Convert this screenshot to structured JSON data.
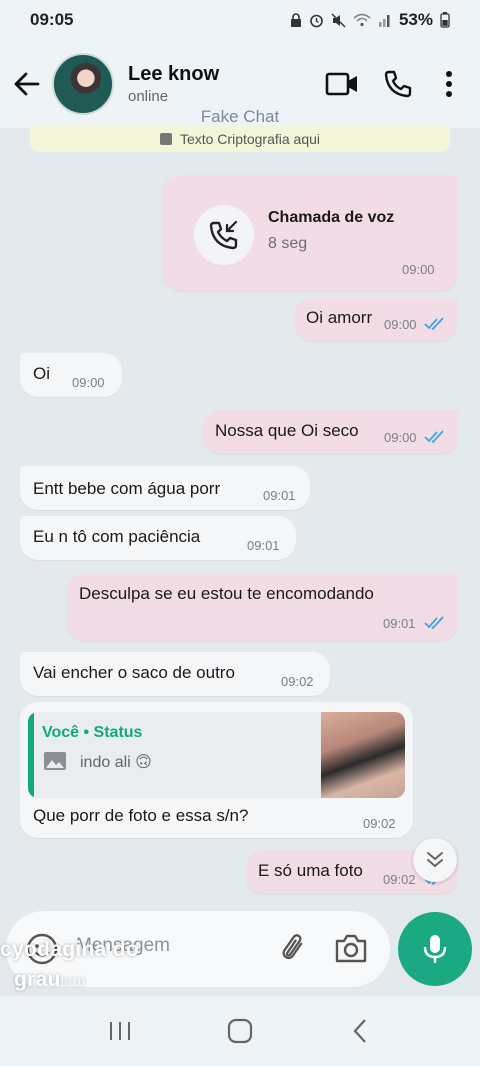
{
  "status_bar": {
    "time": "09:05",
    "battery": "53%",
    "icons": [
      "lock-icon",
      "alarm-icon",
      "mute-icon",
      "wifi-icon",
      "signal-icon",
      "battery-icon"
    ]
  },
  "header": {
    "contact_name": "Lee know",
    "contact_status": "online",
    "watermark": "Fake Chat"
  },
  "encryption_note": "Texto Criptografia aqui",
  "messages": {
    "call": {
      "title": "Chamada de voz",
      "duration": "8 seg",
      "time": "09:00"
    },
    "m1": {
      "text": "Oi amorr",
      "time": "09:00"
    },
    "m2": {
      "text": "Oi",
      "time": "09:00"
    },
    "m3": {
      "text": "Nossa que Oi seco",
      "time": "09:00"
    },
    "m4": {
      "text": "Entt bebe com água porr",
      "time": "09:01"
    },
    "m5": {
      "text": "Eu n tô com paciência",
      "time": "09:01"
    },
    "m6": {
      "text": "Desculpa se eu estou te encomodando",
      "time": "09:01"
    },
    "m7": {
      "text": "Vai encher o saco de outro",
      "time": "09:02"
    },
    "m8": {
      "reply_author": "Você • Status",
      "reply_text": "indo ali 🙃",
      "text": "Que porr de foto e essa s/n?",
      "time": "09:02"
    },
    "m9": {
      "text": "E só uma foto",
      "time": "09:02"
    }
  },
  "composer": {
    "placeholder": "Mensagem"
  },
  "overlay": {
    "line1": "cyodagina do",
    "line2": "grau",
    "line2_suffix": "8/10"
  },
  "colors": {
    "outgoing_bubble": "#f2dce6",
    "incoming_bubble": "#f4f6f8",
    "accent": "#1aa982",
    "read_ticks": "#3aa7e0",
    "background": "#e4e9ee"
  }
}
